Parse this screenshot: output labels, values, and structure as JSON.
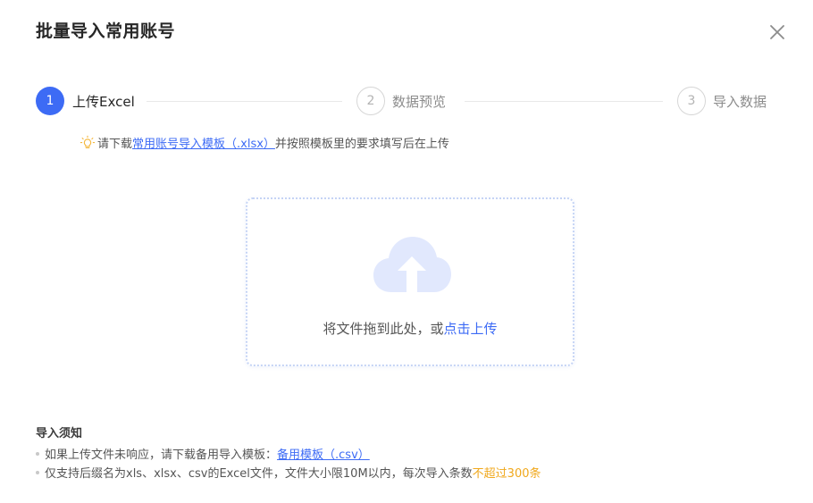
{
  "dialog": {
    "title": "批量导入常用账号",
    "close_icon": "close-icon"
  },
  "steps": [
    {
      "number": "1",
      "label": "上传Excel",
      "state": "active"
    },
    {
      "number": "2",
      "label": "数据预览",
      "state": "inactive"
    },
    {
      "number": "3",
      "label": "导入数据",
      "state": "inactive"
    }
  ],
  "hint": {
    "icon": "lightbulb-icon",
    "prefix": "请下载",
    "link": "常用账号导入模板（.xlsx）",
    "suffix": "并按照模板里的要求填写后在上传"
  },
  "upload": {
    "icon": "cloud-upload-icon",
    "text": "将文件拖到此处，或",
    "link": "点击上传"
  },
  "notes": {
    "title": "导入须知",
    "item1_text": "如果上传文件未响应，请下载备用导入模板：",
    "item1_link": "备用模板（.csv）",
    "item2_text": "仅支持后缀名为xls、xlsx、csv的Excel文件，文件大小限10M以内，每次导入条数",
    "item2_warn": "不超过300条"
  },
  "colors": {
    "primary": "#3d6bf5",
    "warning": "#f0a81c",
    "cloud": "#e1e8fd"
  }
}
